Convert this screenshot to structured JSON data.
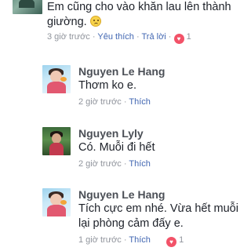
{
  "comments": [
    {
      "text_line1": "Em cũng cho vào khăn lau lên thành",
      "text_line2": "giường.",
      "time": "3 giờ trước",
      "like_label": "Yêu thích",
      "reply_label": "Trả lời",
      "reaction_count": "1"
    },
    {
      "name": "Nguyen Le Hang",
      "text": "Thơm ko e.",
      "time": "2 giờ trước",
      "like_label": "Thích"
    },
    {
      "name": "Nguyen Lyly",
      "text": "Có. Muỗi đi hết",
      "time": "2 giờ trước",
      "like_label": "Thích"
    },
    {
      "name": "Nguyen Le Hang",
      "text_line1": "Tích cực em nhé. Vừa hết muỗi",
      "text_line2": "lại phòng cảm đấy e.",
      "time": "1 giờ trước",
      "like_label": "Thích",
      "reaction_count": "1"
    }
  ],
  "separator": "·",
  "colors": {
    "link": "#4267b2",
    "meta": "#90949c",
    "name": "#4b4f56",
    "heart": "#f25268"
  }
}
